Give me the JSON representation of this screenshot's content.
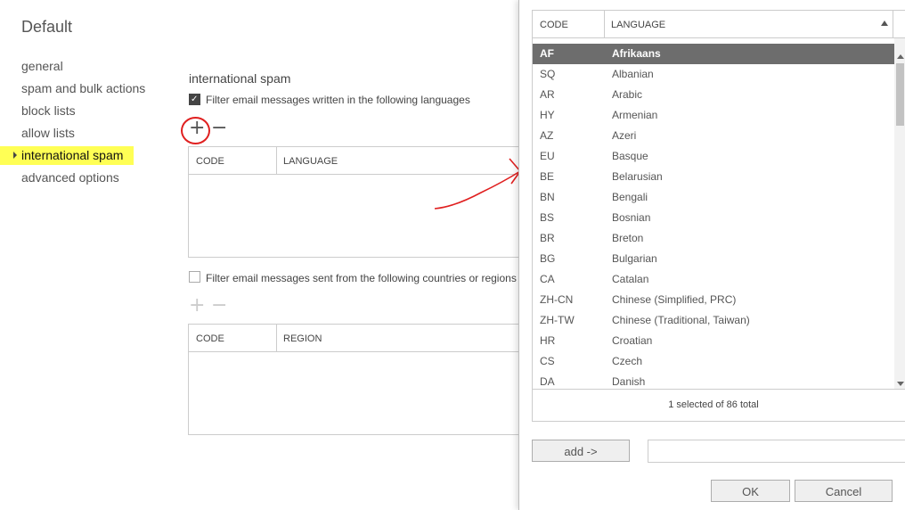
{
  "page": {
    "title": "Default"
  },
  "nav": {
    "items": [
      {
        "label": "general"
      },
      {
        "label": "spam and bulk actions"
      },
      {
        "label": "block lists"
      },
      {
        "label": "allow lists"
      },
      {
        "label": "international spam"
      },
      {
        "label": "advanced options"
      }
    ],
    "active_index": 4
  },
  "main": {
    "section_title": "international spam",
    "language_filter": {
      "label": "Filter email messages written in the following languages",
      "checked": true,
      "add_icon": "plus-icon",
      "remove_icon": "minus-icon",
      "columns": [
        "CODE",
        "LANGUAGE"
      ]
    },
    "region_filter": {
      "label": "Filter email messages sent from the following countries or regions",
      "checked": false,
      "add_icon": "plus-icon",
      "remove_icon": "minus-icon",
      "columns": [
        "CODE",
        "REGION"
      ]
    }
  },
  "picker": {
    "columns": [
      "CODE",
      "LANGUAGE"
    ],
    "sort_icon": "sort-ascending-icon",
    "rows": [
      {
        "code": "AF",
        "name": "Afrikaans",
        "selected": true
      },
      {
        "code": "SQ",
        "name": "Albanian"
      },
      {
        "code": "AR",
        "name": "Arabic"
      },
      {
        "code": "HY",
        "name": "Armenian"
      },
      {
        "code": "AZ",
        "name": "Azeri"
      },
      {
        "code": "EU",
        "name": "Basque"
      },
      {
        "code": "BE",
        "name": "Belarusian"
      },
      {
        "code": "BN",
        "name": "Bengali"
      },
      {
        "code": "BS",
        "name": "Bosnian"
      },
      {
        "code": "BR",
        "name": "Breton"
      },
      {
        "code": "BG",
        "name": "Bulgarian"
      },
      {
        "code": "CA",
        "name": "Catalan"
      },
      {
        "code": "ZH-CN",
        "name": "Chinese (Simplified, PRC)"
      },
      {
        "code": "ZH-TW",
        "name": "Chinese (Traditional, Taiwan)"
      },
      {
        "code": "HR",
        "name": "Croatian"
      },
      {
        "code": "CS",
        "name": "Czech"
      },
      {
        "code": "DA",
        "name": "Danish"
      }
    ],
    "status": "1 selected of 86 total",
    "add_button": "add ->",
    "ok_button": "OK",
    "cancel_button": "Cancel"
  },
  "colors": {
    "highlight": "#ffff55",
    "annotation": "#e02020",
    "selected_row": "#6d6d6d"
  }
}
